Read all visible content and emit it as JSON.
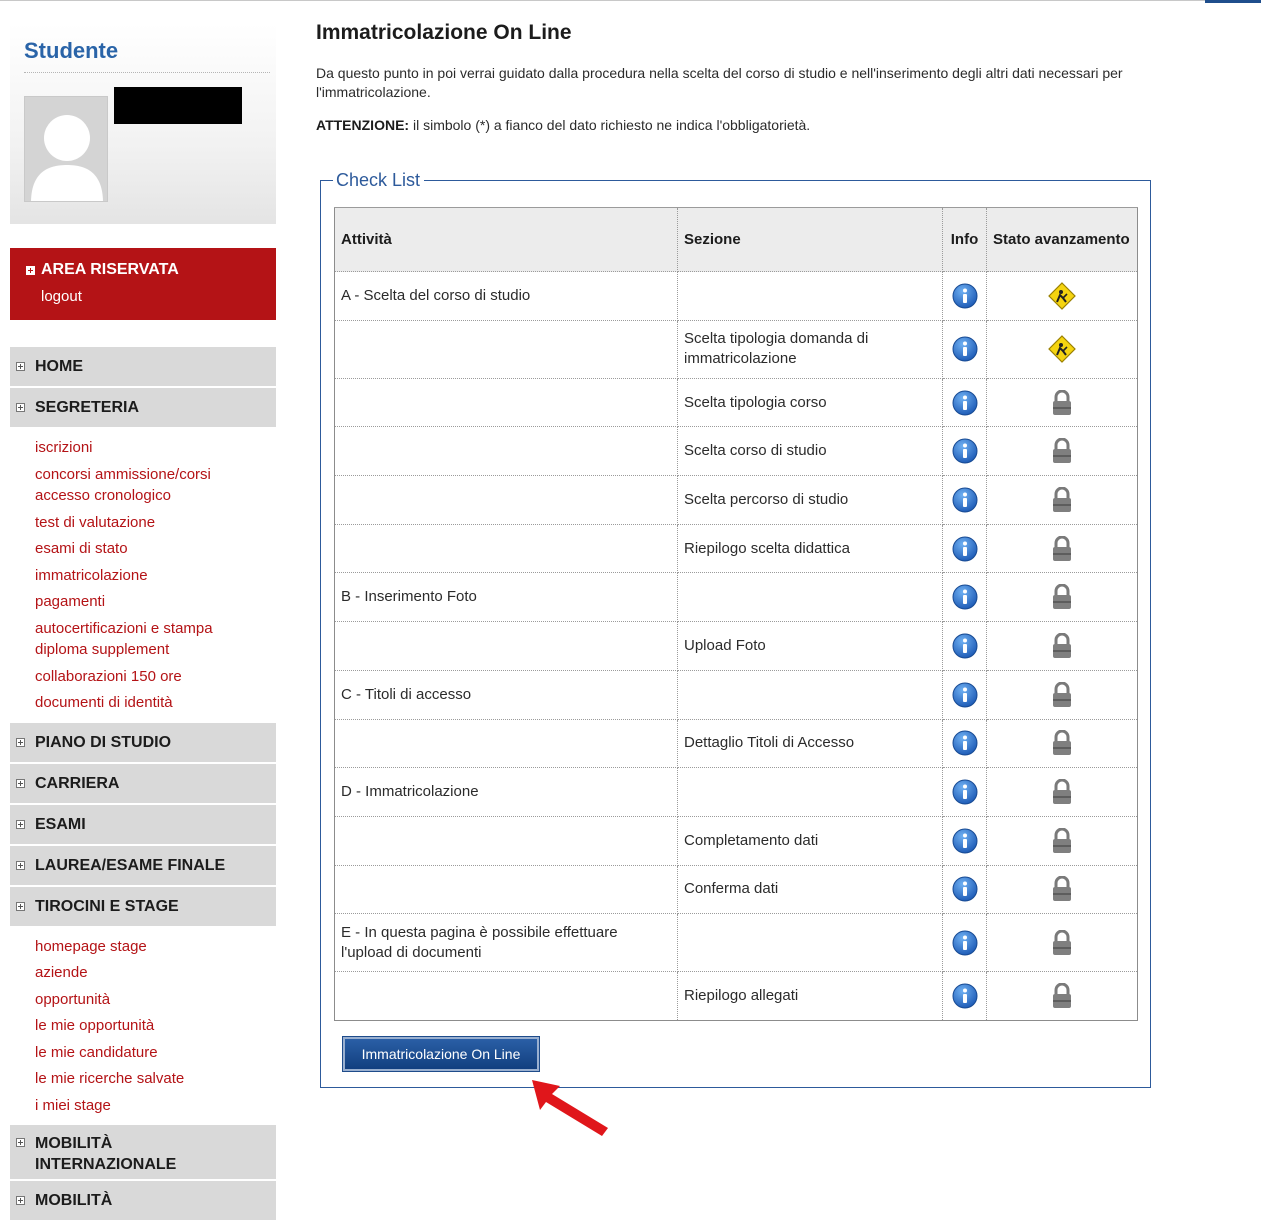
{
  "sidebar": {
    "user_title": "Studente",
    "area_riservata": {
      "title": "AREA RISERVATA",
      "logout": "logout"
    },
    "menu": {
      "home": "HOME",
      "segreteria": "SEGRETERIA",
      "segreteria_items": [
        "iscrizioni",
        "concorsi ammissione/corsi accesso cronologico",
        "test di valutazione",
        "esami di stato",
        "immatricolazione",
        "pagamenti",
        "autocertificazioni e stampa diploma supplement",
        "collaborazioni 150 ore",
        "documenti di identità"
      ],
      "piano_di_studio": "PIANO DI STUDIO",
      "carriera": "CARRIERA",
      "esami": "ESAMI",
      "laurea": "LAUREA/ESAME FINALE",
      "tirocini": "TIROCINI E STAGE",
      "tirocini_items": [
        "homepage stage",
        "aziende",
        "opportunità",
        "le mie opportunità",
        "le mie candidature",
        "le mie ricerche salvate",
        "i miei stage"
      ],
      "mobilita": "MOBILITÀ INTERNAZIONALE",
      "mobilita2": "MOBILITÀ"
    }
  },
  "main": {
    "title": "Immatricolazione On Line",
    "intro": "Da questo punto in poi verrai guidato dalla procedura nella scelta del corso di studio e nell'inserimento degli altri dati necessari per l'immatricolazione.",
    "attention_label": "ATTENZIONE:",
    "attention_text": " il simbolo (*) a fianco del dato richiesto ne indica l'obbligatorietà.",
    "checklist": {
      "legend": "Check List",
      "headers": {
        "attivita": "Attività",
        "sezione": "Sezione",
        "info": "Info",
        "stato": "Stato avanzamento"
      },
      "rows": [
        {
          "attivita": "A - Scelta del corso di studio",
          "sezione": "",
          "stato": "in-progress-icon"
        },
        {
          "attivita": "",
          "sezione": "Scelta tipologia domanda di immatricolazione",
          "stato": "in-progress-icon"
        },
        {
          "attivita": "",
          "sezione": "Scelta tipologia corso",
          "stato": "lock-icon"
        },
        {
          "attivita": "",
          "sezione": "Scelta corso di studio",
          "stato": "lock-icon"
        },
        {
          "attivita": "",
          "sezione": "Scelta percorso di studio",
          "stato": "lock-icon"
        },
        {
          "attivita": "",
          "sezione": "Riepilogo scelta didattica",
          "stato": "lock-icon"
        },
        {
          "attivita": "B - Inserimento Foto",
          "sezione": "",
          "stato": "lock-icon"
        },
        {
          "attivita": "",
          "sezione": "Upload Foto",
          "stato": "lock-icon"
        },
        {
          "attivita": "C - Titoli di accesso",
          "sezione": "",
          "stato": "lock-icon"
        },
        {
          "attivita": "",
          "sezione": "Dettaglio Titoli di Accesso",
          "stato": "lock-icon"
        },
        {
          "attivita": "D - Immatricolazione",
          "sezione": "",
          "stato": "lock-icon"
        },
        {
          "attivita": "",
          "sezione": "Completamento dati",
          "stato": "lock-icon"
        },
        {
          "attivita": "",
          "sezione": "Conferma dati",
          "stato": "lock-icon"
        },
        {
          "attivita": "E - In questa pagina è possibile effettuare l'upload di documenti",
          "sezione": "",
          "stato": "lock-icon"
        },
        {
          "attivita": "",
          "sezione": "Riepilogo allegati",
          "stato": "lock-icon"
        }
      ],
      "button": "Immatricolazione On Line"
    }
  },
  "colors": {
    "accent_red": "#b41316",
    "accent_blue": "#2d5a9b",
    "arrow_red": "#e0161b"
  }
}
